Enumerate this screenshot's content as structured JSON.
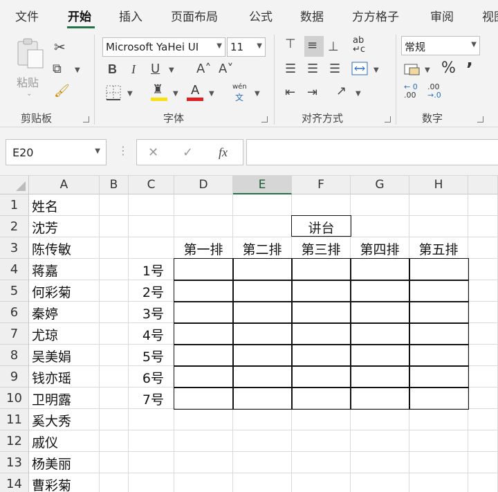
{
  "tabs": [
    "文件",
    "开始",
    "插入",
    "页面布局",
    "公式",
    "数据",
    "方方格子",
    "审阅",
    "视图"
  ],
  "active_tab": "开始",
  "ribbon": {
    "clipboard": {
      "paste_label": "粘贴",
      "group_label": "剪贴板"
    },
    "font": {
      "font_name": "Microsoft YaHei UI",
      "font_size": "11",
      "group_label": "字体",
      "bold": "B",
      "italic": "I",
      "underline": "U",
      "grow": "A˄",
      "shrink": "A˅",
      "phonetic_top": "wén",
      "phonetic_bottom": "文",
      "fill_color": "#f7e016",
      "font_color": "#e02020"
    },
    "alignment": {
      "group_label": "对齐方式",
      "wrap_label": "ab↵c"
    },
    "number": {
      "format": "常规",
      "percent": "%",
      "comma": "’",
      "inc_decimal_top": "← 0",
      "inc_decimal_bottom": ".00",
      "dec_decimal_top": ".00",
      "dec_decimal_bottom": "→.0",
      "group_label": "数字"
    }
  },
  "formula_bar": {
    "name_box": "E20",
    "formula": "",
    "fx": "fx",
    "cancel": "✕",
    "enter": "✓",
    "dots": "⋮"
  },
  "selected_column": "E",
  "columns": [
    "A",
    "B",
    "C",
    "D",
    "E",
    "F",
    "G",
    "H"
  ],
  "rows": [
    "1",
    "2",
    "3",
    "4",
    "5",
    "6",
    "7",
    "8",
    "9",
    "10",
    "11",
    "12",
    "13",
    "14"
  ],
  "col_a": [
    "姓名",
    "沈芳",
    "陈传敏",
    "蒋嘉",
    "何彩菊",
    "秦婷",
    "尤琼",
    "吴美娟",
    "钱亦瑶",
    "卫明露",
    "奚大秀",
    "戚仪",
    "杨美丽",
    "曹彩菊"
  ],
  "podium": "讲台",
  "row_labels": [
    "第一排",
    "第二排",
    "第三排",
    "第四排",
    "第五排"
  ],
  "seat_numbers": [
    "1号",
    "2号",
    "3号",
    "4号",
    "5号",
    "6号",
    "7号"
  ]
}
